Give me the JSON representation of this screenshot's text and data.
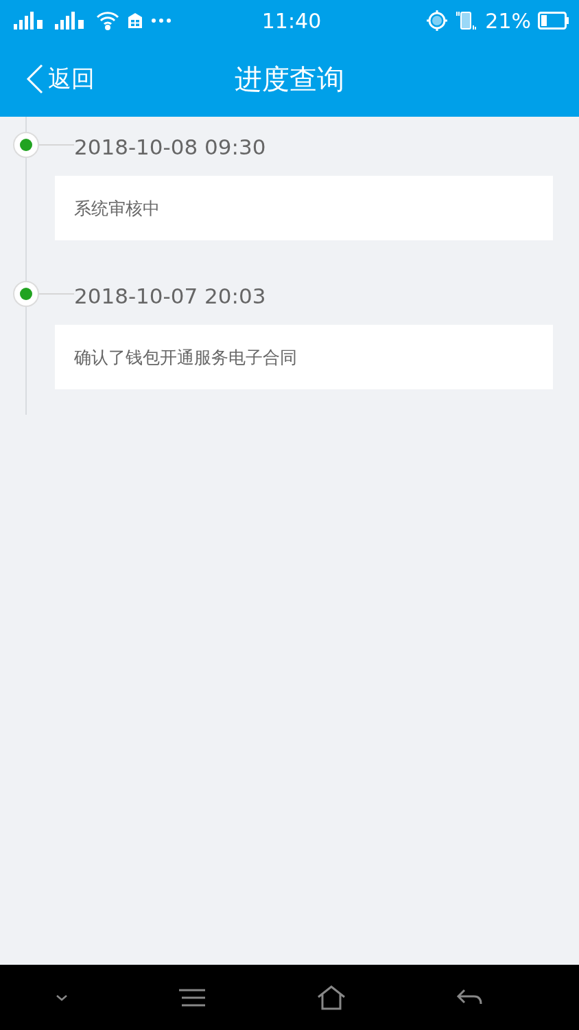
{
  "status_bar": {
    "time": "11:40",
    "battery": "21%"
  },
  "header": {
    "back": "返回",
    "title": "进度查询"
  },
  "timeline": [
    {
      "time": "2018-10-08 09:30",
      "text": "系统审核中"
    },
    {
      "time": "2018-10-07 20:03",
      "text": "确认了钱包开通服务电子合同"
    }
  ]
}
